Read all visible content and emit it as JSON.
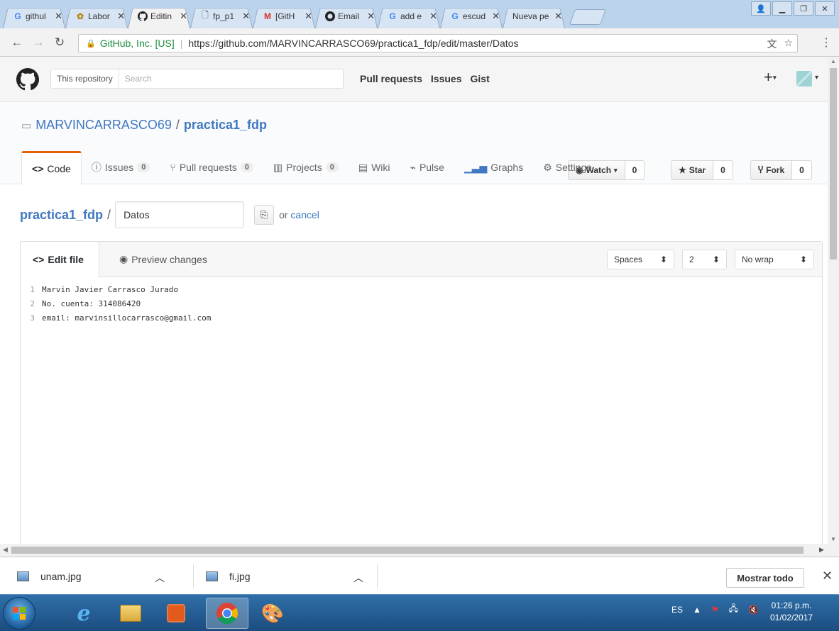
{
  "browser": {
    "tabs": [
      {
        "title": "githul",
        "icon": "google-icon"
      },
      {
        "title": "Labor",
        "icon": "unam-icon"
      },
      {
        "title": "Editin",
        "icon": "github-icon",
        "active": true
      },
      {
        "title": "fp_p1",
        "icon": "document-icon"
      },
      {
        "title": "[GitH",
        "icon": "gmail-icon"
      },
      {
        "title": "Email",
        "icon": "github-icon"
      },
      {
        "title": "add e",
        "icon": "google-icon"
      },
      {
        "title": "escud",
        "icon": "google-icon"
      },
      {
        "title": "Nueva pe",
        "icon": "none"
      }
    ],
    "secure_label": "GitHub, Inc. [US]",
    "url": "https://github.com/MARVINCARRASCO69/practica1_fdp/edit/master/Datos"
  },
  "gh_header": {
    "scope": "This repository",
    "search_placeholder": "Search",
    "nav": [
      "Pull requests",
      "Issues",
      "Gist"
    ]
  },
  "repo": {
    "owner": "MARVINCARRASCO69",
    "name": "practica1_fdp",
    "watch_label": "Watch",
    "watch_count": "0",
    "star_label": "Star",
    "star_count": "0",
    "fork_label": "Fork",
    "fork_count": "0",
    "tabs": [
      {
        "label": "Code",
        "icon": "code-icon"
      },
      {
        "label": "Issues",
        "count": "0",
        "icon": "issue-icon"
      },
      {
        "label": "Pull requests",
        "count": "0",
        "icon": "pull-request-icon"
      },
      {
        "label": "Projects",
        "count": "0",
        "icon": "project-icon"
      },
      {
        "label": "Wiki",
        "icon": "wiki-icon"
      },
      {
        "label": "Pulse",
        "icon": "pulse-icon"
      },
      {
        "label": "Graphs",
        "icon": "graph-icon"
      },
      {
        "label": "Settings",
        "icon": "gear-icon"
      }
    ]
  },
  "edit": {
    "repo_link": "practica1_fdp",
    "filename": "Datos",
    "or_text": "or",
    "cancel": "cancel",
    "tab_edit": "Edit file",
    "tab_preview": "Preview changes",
    "indent_mode": "Spaces",
    "indent_size": "2",
    "wrap_mode": "No wrap",
    "lines": [
      {
        "n": "1",
        "text": "Marvin Javier Carrasco Jurado"
      },
      {
        "n": "2",
        "text": "No. cuenta: 314086420"
      },
      {
        "n": "3",
        "text": "email: marvinsillocarrasco@gmail.com"
      }
    ]
  },
  "downloads": {
    "items": [
      "unam.jpg",
      "fi.jpg"
    ],
    "show_all": "Mostrar todo"
  },
  "taskbar": {
    "lang": "ES",
    "time": "01:26 p.m.",
    "date": "01/02/2017"
  }
}
